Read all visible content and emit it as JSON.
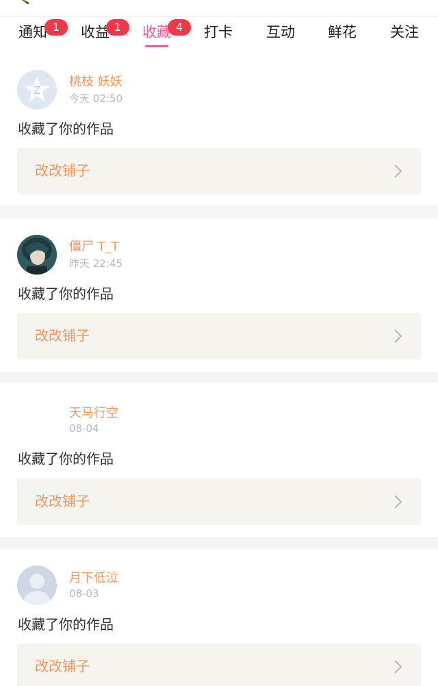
{
  "tabs": [
    {
      "label": "通知",
      "badge": "1"
    },
    {
      "label": "收益",
      "badge": "1"
    },
    {
      "label": "收藏",
      "badge": "4",
      "active": true
    },
    {
      "label": "打卡"
    },
    {
      "label": "互动"
    },
    {
      "label": "鲜花"
    },
    {
      "label": "关注"
    }
  ],
  "colors": {
    "accent": "#f25b95",
    "badge": "#f73548",
    "name": "#f0985d"
  },
  "notifications": [
    {
      "user": "桃枝 妖妖",
      "time": "今天 02:50",
      "action": "收藏了你的作品",
      "work": "改改铺子",
      "avatar_icon": "qq-star-avatar-icon"
    },
    {
      "user": "僵尸 T_T",
      "time": "昨天 22:45",
      "action": "收藏了你的作品",
      "work": "改改铺子",
      "avatar_icon": "anime-character-avatar"
    },
    {
      "user": "天马行空",
      "time": "08-04",
      "action": "收藏了你的作品",
      "work": "改改铺子",
      "avatar_icon": "blank-avatar"
    },
    {
      "user": "月下低泣",
      "time": "08-03",
      "action": "收藏了你的作品",
      "work": "改改铺子",
      "avatar_icon": "default-person-avatar-icon"
    }
  ]
}
